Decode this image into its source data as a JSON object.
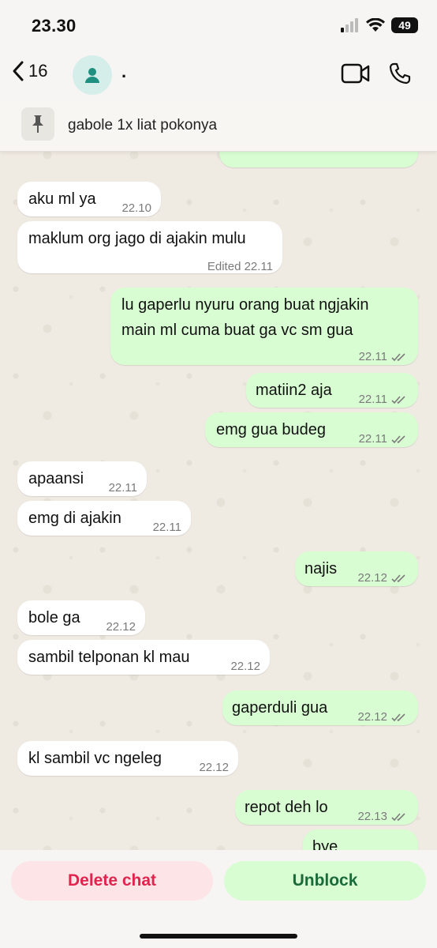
{
  "status_bar": {
    "time": "23.30",
    "battery": "49"
  },
  "header": {
    "back_count": "16",
    "contact_name": "."
  },
  "pinned": {
    "text": "gabole 1x liat pokonya"
  },
  "messages": [
    {
      "text": "aku ml ya",
      "time": "22.10",
      "dir": "in"
    },
    {
      "text": "maklum org jago di ajakin mulu",
      "time": "Edited 22.11",
      "dir": "in"
    },
    {
      "text": "lu gaperlu nyuru orang buat ngjakin\nmain ml cuma buat ga vc sm gua",
      "time": "22.11",
      "dir": "out"
    },
    {
      "text": "matiin2 aja",
      "time": "22.11",
      "dir": "out"
    },
    {
      "text": "emg gua budeg",
      "time": "22.11",
      "dir": "out"
    },
    {
      "text": "apaansi",
      "time": "22.11",
      "dir": "in"
    },
    {
      "text": "emg di ajakin",
      "time": "22.11",
      "dir": "in"
    },
    {
      "text": "najis",
      "time": "22.12",
      "dir": "out"
    },
    {
      "text": "bole ga",
      "time": "22.12",
      "dir": "in"
    },
    {
      "text": "sambil telponan kl mau",
      "time": "22.12",
      "dir": "in"
    },
    {
      "text": "gaperduli gua",
      "time": "22.12",
      "dir": "out"
    },
    {
      "text": "kl sambil vc ngeleg",
      "time": "22.12",
      "dir": "in"
    },
    {
      "text": "repot deh lo",
      "time": "22.13",
      "dir": "out"
    },
    {
      "text": "bye",
      "time": "",
      "dir": "out"
    }
  ],
  "actions": {
    "delete_label": "Delete chat",
    "unblock_label": "Unblock"
  },
  "colors": {
    "incoming": "#ffffff",
    "outgoing": "#d9fdd3",
    "delete": "#e0244e",
    "unblock": "#1a6b3a",
    "accent": "#25a18e"
  }
}
